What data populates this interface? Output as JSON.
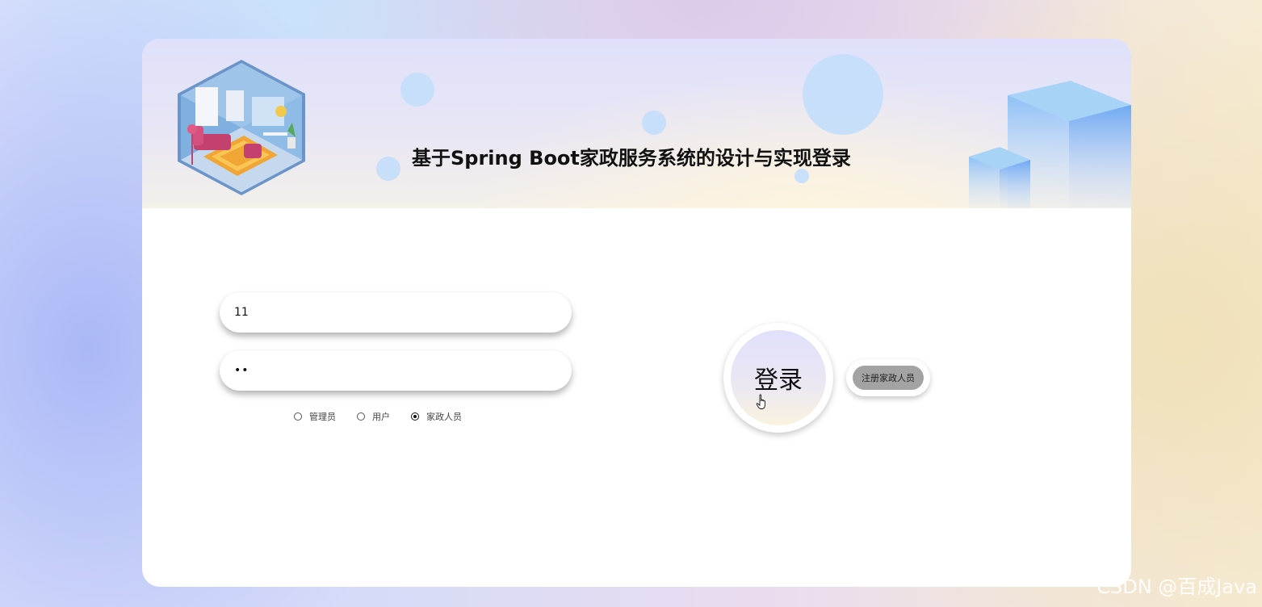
{
  "header": {
    "title": "基于Spring Boot家政服务系统的设计与实现登录"
  },
  "form": {
    "username_value": "11",
    "password_value": "11",
    "roles": [
      {
        "label": "管理员",
        "checked": false
      },
      {
        "label": "用户",
        "checked": false
      },
      {
        "label": "家政人员",
        "checked": true
      }
    ]
  },
  "actions": {
    "login_label": "登录",
    "register_label": "注册家政人员"
  },
  "watermark": "CSDN @百成Java",
  "icons": {
    "room": "room-illustration-icon",
    "cubes": "cubes-decoration-icon",
    "cursor": "hand-pointer-icon"
  },
  "colors": {
    "register_button_bg": "#a3a3a3",
    "bubble": "#c5defa"
  }
}
